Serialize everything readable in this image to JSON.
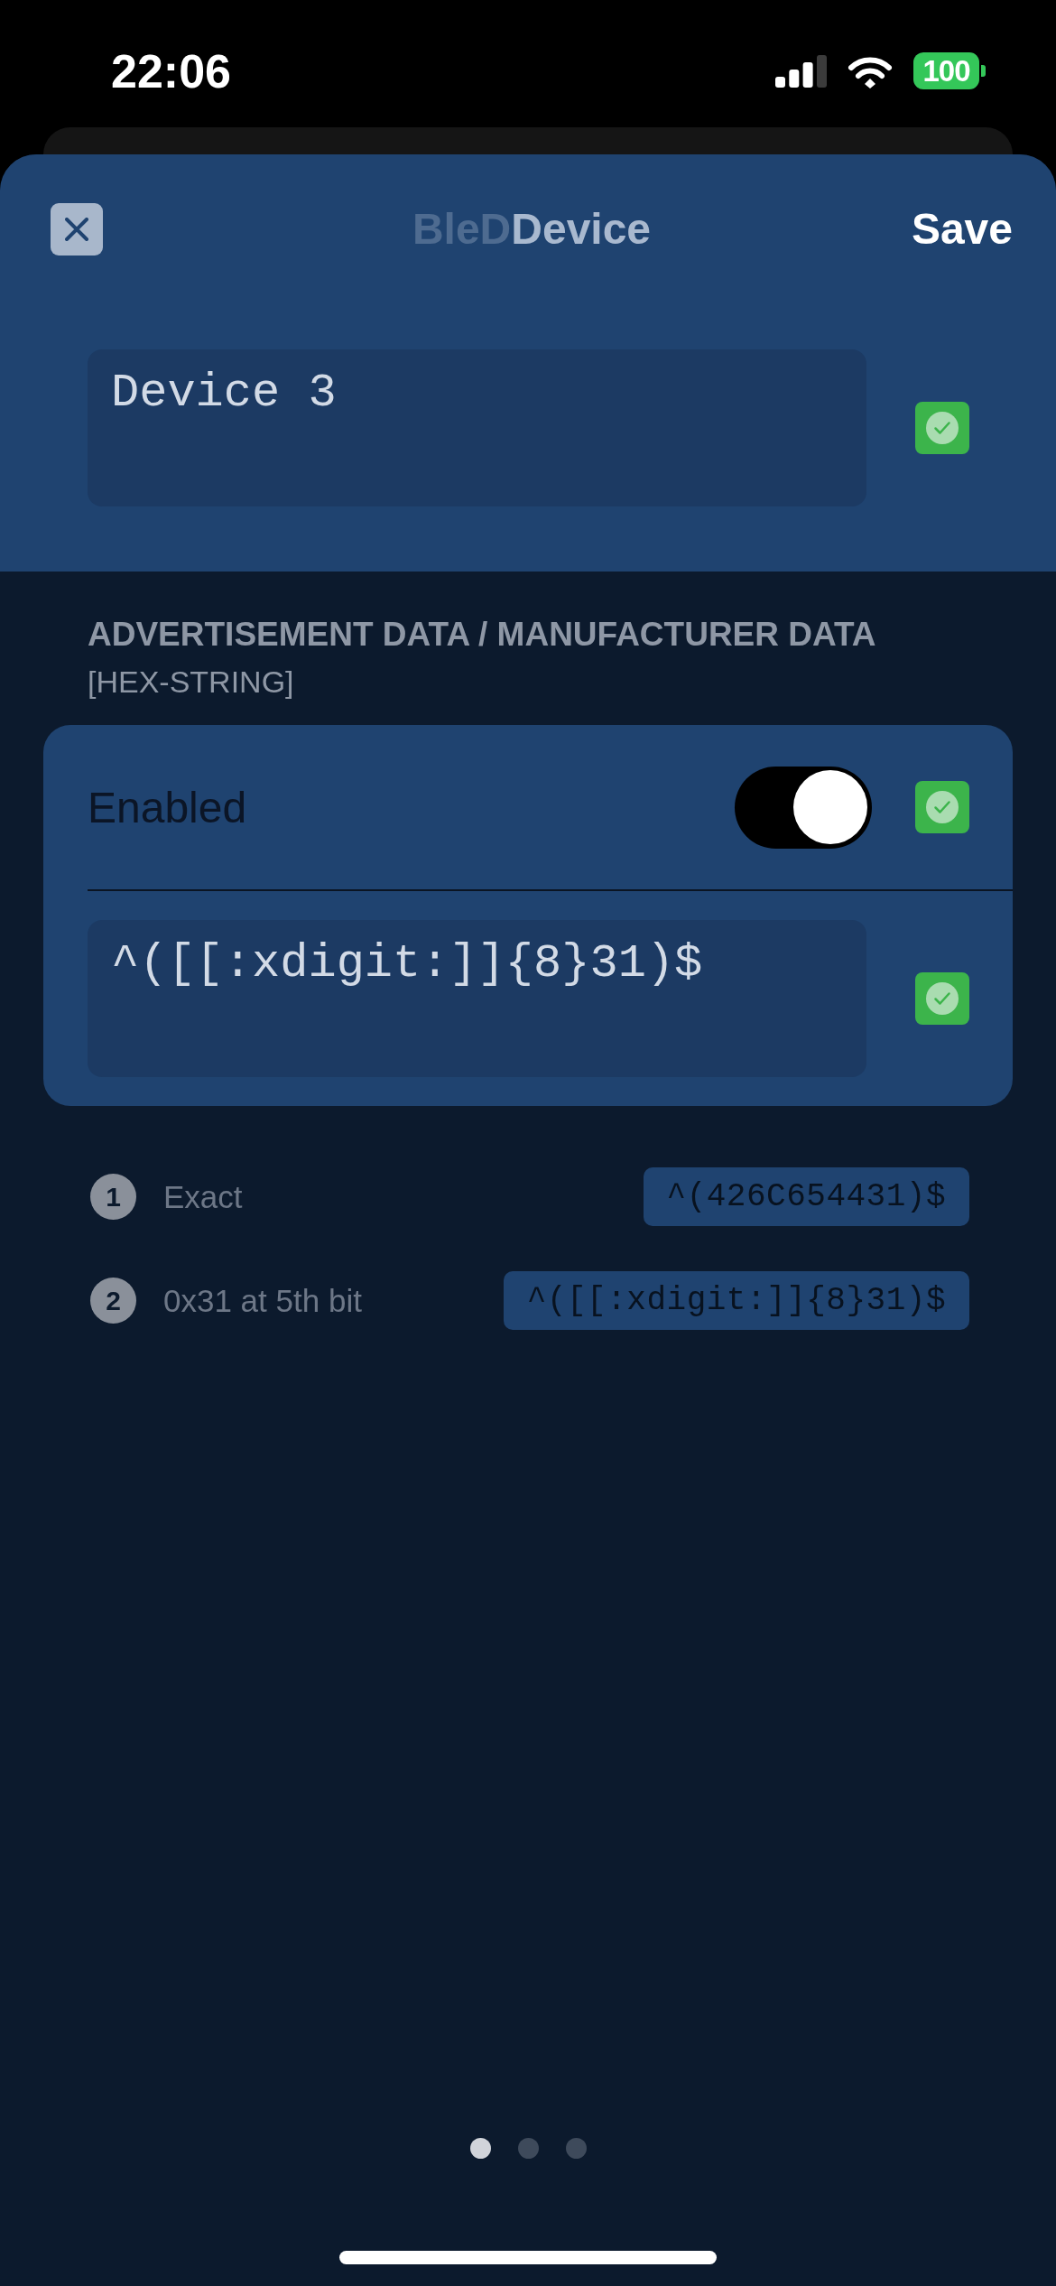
{
  "status_bar": {
    "time": "22:06",
    "battery": "100"
  },
  "header": {
    "title_prefix": "BleD",
    "title": "Device",
    "save": "Save"
  },
  "name_field": {
    "value": "Device 3",
    "valid": true
  },
  "section": {
    "title": "ADVERTISEMENT DATA / MANUFACTURER DATA",
    "subtitle": "[HEX-STRING]"
  },
  "filter": {
    "label": "Enabled",
    "on": true,
    "label_valid": true,
    "pattern": "^([[:xdigit:]]{8}31)$",
    "pattern_valid": true
  },
  "examples": [
    {
      "number": "1",
      "label": "Exact",
      "pattern": "^(426C654431)$"
    },
    {
      "number": "2",
      "label": "0x31 at 5th bit",
      "pattern": "^([[:xdigit:]]{8}31)$"
    }
  ],
  "pager": [
    {
      "selected": true
    },
    {
      "selected": false
    },
    {
      "selected": false
    }
  ]
}
